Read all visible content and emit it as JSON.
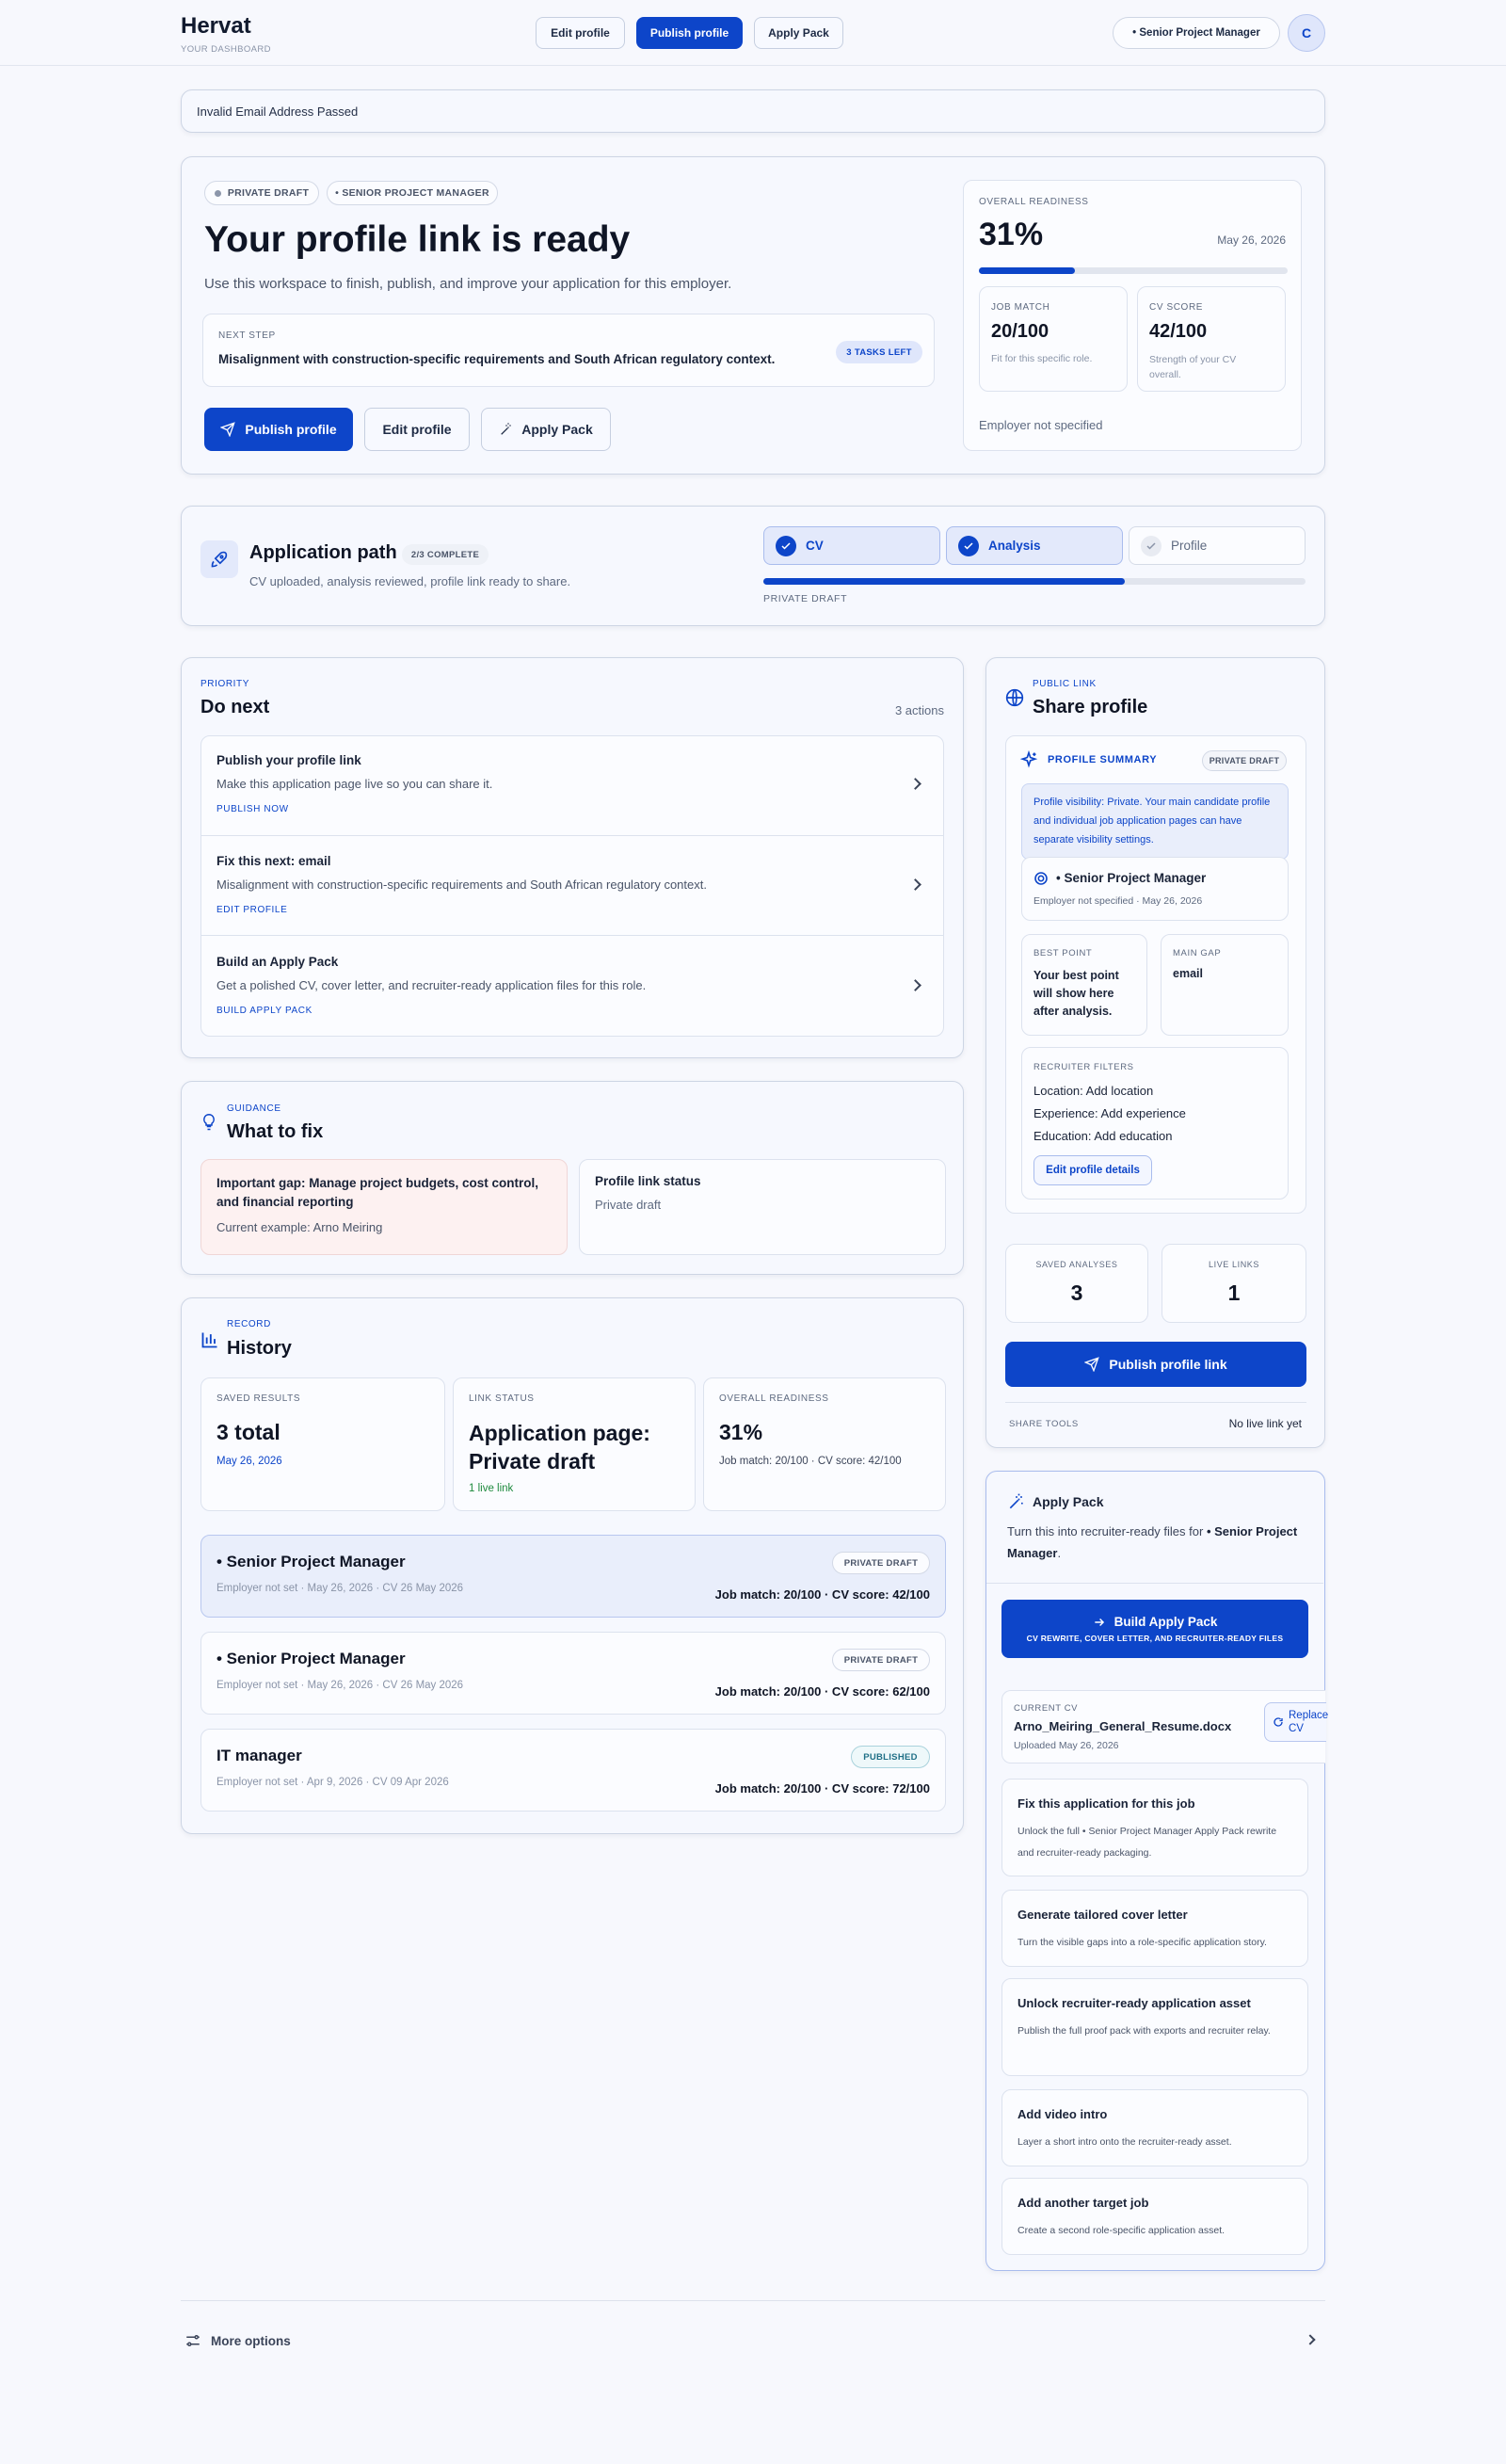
{
  "header": {
    "brand": "Hervat",
    "subtitle": "YOUR DASHBOARD",
    "edit_profile": "Edit profile",
    "publish_profile": "Publish profile",
    "apply_pack": "Apply Pack",
    "role_chip": "• Senior Project Manager",
    "avatar_initial": "C"
  },
  "alert": {
    "text": "Invalid Email Address Passed"
  },
  "hero": {
    "badge_draft": "PRIVATE DRAFT",
    "badge_role": "• SENIOR PROJECT MANAGER",
    "title": "Your profile link is ready",
    "subtitle": "Use this workspace to finish, publish, and improve your application for this employer.",
    "next_step_label": "NEXT STEP",
    "next_step_text": "Misalignment with construction-specific requirements and South African regulatory context.",
    "tasks_left": "3 TASKS LEFT",
    "publish_btn": "Publish profile",
    "edit_btn": "Edit profile",
    "apply_btn": "Apply Pack"
  },
  "readiness": {
    "label": "OVERALL READINESS",
    "value": "31%",
    "progress": 0.31,
    "date": "May 26, 2026",
    "job_match_label": "JOB MATCH",
    "job_match_value": "20/100",
    "job_match_desc": "Fit for this specific role.",
    "cv_score_label": "CV SCORE",
    "cv_score_value": "42/100",
    "cv_score_desc": "Strength of your CV overall.",
    "employer": "Employer not specified"
  },
  "path": {
    "title": "Application path",
    "complete": "2/3 COMPLETE",
    "subtitle": "CV uploaded, analysis reviewed, profile link ready to share.",
    "steps": [
      {
        "label": "CV",
        "done": true
      },
      {
        "label": "Analysis",
        "done": true
      },
      {
        "label": "Profile",
        "done": false
      }
    ],
    "progress": 0.667,
    "status": "PRIVATE DRAFT"
  },
  "do_next": {
    "eyebrow": "PRIORITY",
    "title": "Do next",
    "count": "3 actions",
    "items": [
      {
        "title": "Publish your profile link",
        "desc": "Make this application page live so you can share it.",
        "action": "PUBLISH NOW"
      },
      {
        "title": "Fix this next: email",
        "desc": "Misalignment with construction-specific requirements and South African regulatory context.",
        "action": "EDIT PROFILE"
      },
      {
        "title": "Build an Apply Pack",
        "desc": "Get a polished CV, cover letter, and recruiter-ready application files for this role.",
        "action": "BUILD APPLY PACK"
      }
    ]
  },
  "fix": {
    "eyebrow": "GUIDANCE",
    "title": "What to fix",
    "gap_title": "Important gap: Manage project budgets, cost control, and financial reporting",
    "gap_example": "Current example: Arno Meiring",
    "status_title": "Profile link status",
    "status_value": "Private draft"
  },
  "history": {
    "eyebrow": "RECORD",
    "title": "History",
    "saved_label": "SAVED RESULTS",
    "saved_value": "3 total",
    "saved_date": "May 26, 2026",
    "link_label": "LINK STATUS",
    "link_value": "Application page: Private draft",
    "link_live": "1 live link",
    "ready_label": "OVERALL READINESS",
    "ready_value": "31%",
    "ready_detail": "Job match: 20/100 · CV score: 42/100",
    "rows": [
      {
        "title": "• Senior Project Manager",
        "meta": "Employer not set · May 26, 2026 · CV 26 May 2026",
        "badge": "PRIVATE DRAFT",
        "scores": "Job match: 20/100 · CV score: 42/100"
      },
      {
        "title": "• Senior Project Manager",
        "meta": "Employer not set · May 26, 2026 · CV 26 May 2026",
        "badge": "PRIVATE DRAFT",
        "scores": "Job match: 20/100 · CV score: 62/100"
      },
      {
        "title": "IT manager",
        "meta": "Employer not set · Apr 9, 2026 · CV 09 Apr 2026",
        "badge": "PUBLISHED",
        "scores": "Job match: 20/100 · CV score: 72/100"
      }
    ]
  },
  "share": {
    "eyebrow": "PUBLIC LINK",
    "title": "Share profile",
    "summary_label": "PROFILE SUMMARY",
    "summary_badge": "PRIVATE DRAFT",
    "visibility_note": "Profile visibility: Private. Your main candidate profile and individual job application pages can have separate visibility settings.",
    "role": "• Senior Project Manager",
    "role_meta": "Employer not specified · May 26, 2026",
    "best_label": "BEST POINT",
    "best_value": "Your best point will show here after analysis.",
    "gap_label": "MAIN GAP",
    "gap_value": "email",
    "filters_label": "RECRUITER FILTERS",
    "filter_location": "Location: Add location",
    "filter_experience": "Experience: Add experience",
    "filter_education": "Education: Add education",
    "edit_details": "Edit profile details",
    "saved_label": "SAVED ANALYSES",
    "saved_value": "3",
    "live_label": "LIVE LINKS",
    "live_value": "1",
    "publish_link": "Publish profile link",
    "tools_label": "SHARE TOOLS",
    "no_live": "No live link yet"
  },
  "apply_pack": {
    "title": "Apply Pack",
    "desc_prefix": "Turn this into recruiter-ready files for ",
    "desc_role": "• Senior Project Manager",
    "desc_suffix": ".",
    "build_btn": "Build Apply Pack",
    "build_sub": "CV REWRITE, COVER LETTER, AND RECRUITER-READY FILES",
    "cv_label": "CURRENT CV",
    "cv_file": "Arno_Meiring_General_Resume.docx",
    "cv_uploaded": "Uploaded May 26, 2026",
    "replace": "Replace CV",
    "items": [
      {
        "title": "Fix this application for this job",
        "desc": "Unlock the full • Senior Project Manager Apply Pack rewrite and recruiter-ready packaging."
      },
      {
        "title": "Generate tailored cover letter",
        "desc": "Turn the visible gaps into a role-specific application story."
      },
      {
        "title": "Unlock recruiter-ready application asset",
        "desc": "Publish the full proof pack with exports and recruiter relay."
      },
      {
        "title": "Add video intro",
        "desc": "Layer a short intro onto the recruiter-ready asset."
      },
      {
        "title": "Add another target job",
        "desc": "Create a second role-specific application asset."
      }
    ]
  },
  "footer": {
    "more_options": "More options"
  },
  "colors": {
    "primary": "#0d45c9",
    "background": "#f7f8fd",
    "card": "#f6f8fe",
    "danger_bg": "#fdf1f1",
    "success": "#1e8a3e"
  }
}
